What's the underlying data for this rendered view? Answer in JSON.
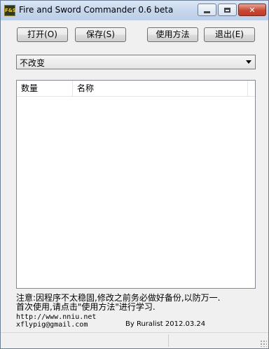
{
  "window": {
    "app_icon_text": "F&S",
    "title": "Fire and Sword Commander 0.6 beta"
  },
  "toolbar": {
    "open_label": "打开(O)",
    "save_label": "保存(S)",
    "help_label": "使用方法",
    "exit_label": "退出(E)"
  },
  "combo": {
    "selected": "不改变"
  },
  "list": {
    "columns": [
      "数量",
      "名称"
    ],
    "rows": []
  },
  "footer": {
    "note_1": "注意:因程序不太稳固,修改之前务必做好备份,以防万一.",
    "note_2": "首次使用,请点击\"使用方法\"进行学习.",
    "url": "http://www.nniu.net",
    "email": "xflypig@gmail.com",
    "author": "By Ruralist 2012.03.24"
  },
  "icons": {
    "minimize": "minimize-icon",
    "maximize": "maximize-icon",
    "close": "close-icon",
    "dropdown": "chevron-down-icon"
  }
}
